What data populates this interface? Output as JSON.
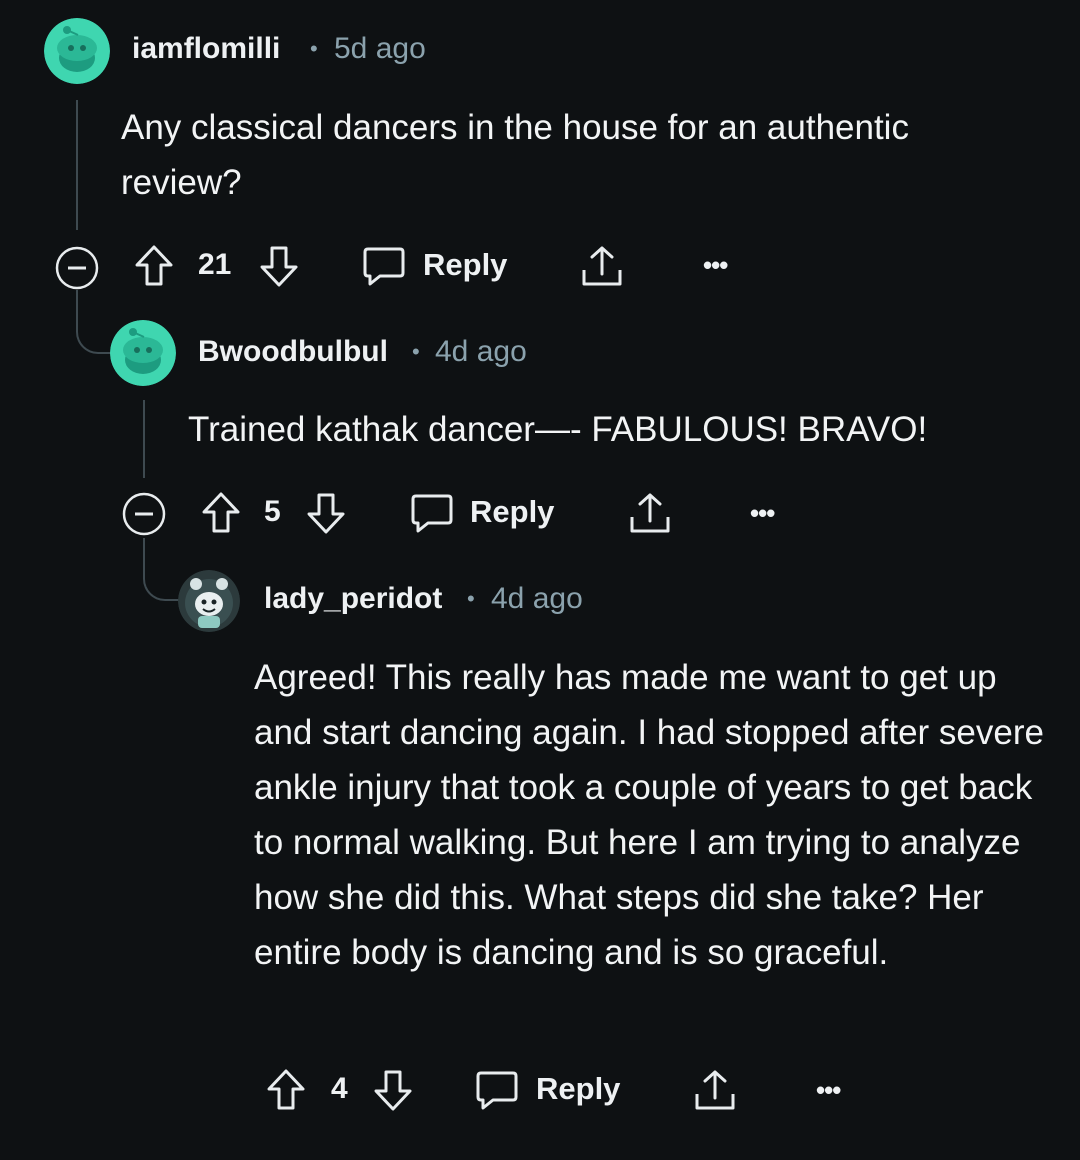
{
  "comments": [
    {
      "author": "iamflomilli",
      "separator": "•",
      "time": "5d ago",
      "body": "Any classical dancers in the house for an authentic review?",
      "votes": "21",
      "reply_label": "Reply",
      "more_label": "•••",
      "avatar_icon": "snoo-avatar-icon"
    },
    {
      "author": "Bwoodbulbul",
      "separator": "•",
      "time": "4d ago",
      "body": "Trained kathak dancer—- FABULOUS! BRAVO!",
      "votes": "5",
      "reply_label": "Reply",
      "more_label": "•••",
      "avatar_icon": "snoo-avatar-icon"
    },
    {
      "author": "lady_peridot",
      "separator": "•",
      "time": "4d ago",
      "body": "Agreed! This really has made me want to get up and start dancing again. I had stopped after severe ankle injury that took a couple of years to get back to normal walking. But here I am trying to analyze how she did this. What steps did she take? Her entire body is dancing and is so graceful.",
      "votes": "4",
      "reply_label": "Reply",
      "more_label": "•••",
      "avatar_icon": "custom-avatar-icon"
    }
  ],
  "colors": {
    "background": "#0e1113",
    "avatar_teal": "#3fd6b0",
    "thread_line": "#3e4a50",
    "meta_text": "#8ba2ad"
  }
}
